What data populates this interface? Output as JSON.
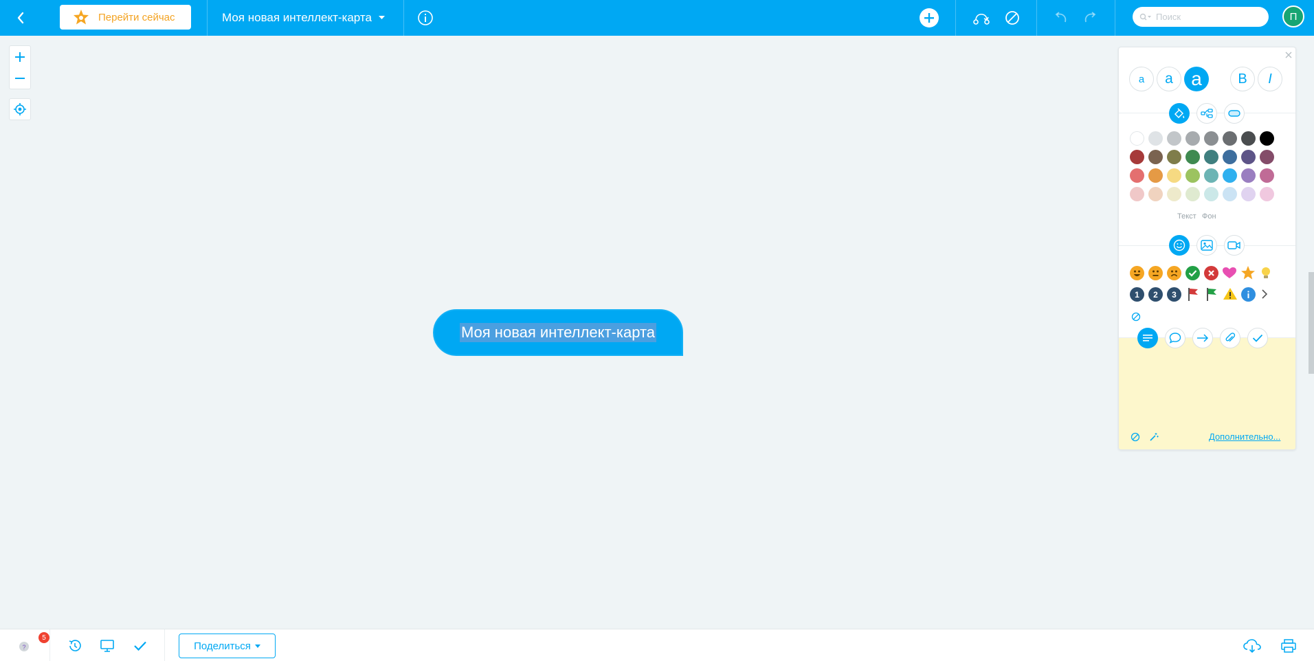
{
  "topbar": {
    "upgrade_label": "Перейти сейчас",
    "map_title": "Моя новая интеллект-карта",
    "search_placeholder": "Поиск",
    "avatar_initial": "П"
  },
  "node": {
    "text": "Моя новая интеллект-карта"
  },
  "panel": {
    "font_sizes": [
      "a",
      "a",
      "a"
    ],
    "bold_label": "B",
    "italic_label": "I",
    "text_label": "Текст",
    "background_label": "Фон",
    "more_label": "Дополнительно...",
    "number_icons": [
      "1",
      "2",
      "3"
    ],
    "palette": [
      [
        "#ffffff",
        "#dfe3e6",
        "#c2c6c9",
        "#a7abae",
        "#8b8f92",
        "#6b6e71",
        "#4a4d4f",
        "#000000"
      ],
      [
        "#a63a3a",
        "#7a6350",
        "#7f7d4a",
        "#3f8a50",
        "#3f7f7f",
        "#3d6e9e",
        "#5d5487",
        "#844c69"
      ],
      [
        "#e46f6f",
        "#e59a45",
        "#f6da82",
        "#9cc360",
        "#6cb4b4",
        "#2fb0ef",
        "#9a7ec0",
        "#c06b96"
      ],
      [
        "#f0c8c8",
        "#f0d3bf",
        "#eeeacb",
        "#dfead0",
        "#cbe8e8",
        "#cbe3f4",
        "#e0d3f0",
        "#f0c8df"
      ]
    ]
  },
  "bottombar": {
    "notification_count": "5",
    "share_label": "Поделиться"
  },
  "colors": {
    "accent": "#00a8f3",
    "canvas": "#eff4f6",
    "note": "#fdf7cc"
  }
}
